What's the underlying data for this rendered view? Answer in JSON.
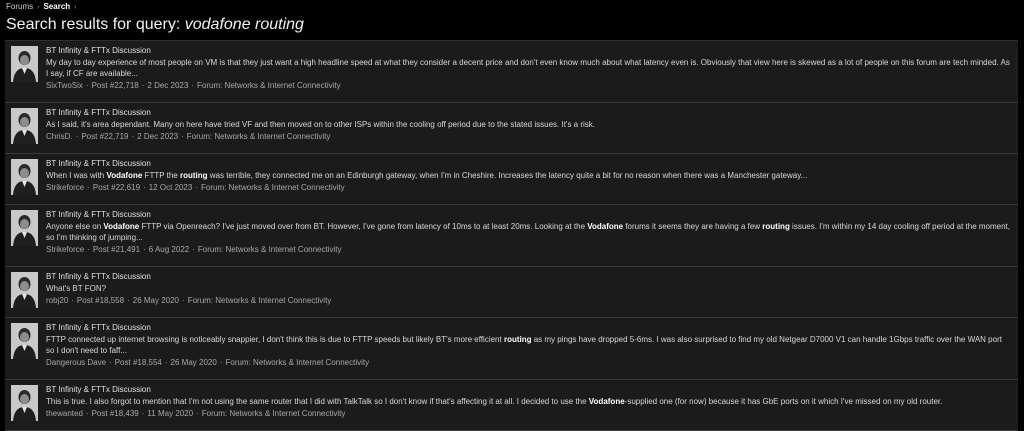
{
  "breadcrumb": {
    "forums": "Forums",
    "search": "Search"
  },
  "page": {
    "title_prefix": "Search results for query:",
    "query": "vodafone routing"
  },
  "results": [
    {
      "thread": "BT Infinity & FTTx Discussion",
      "snippet_html": "My day to day experience of most people on VM is that they just want a high headline speed at what they consider a decent price and don't even know much about what latency even is. Obviously that view here is skewed as a lot of people on this forum are tech minded. As I say, if CF are available...",
      "author": "SixTwoSix",
      "post": "Post #22,718",
      "date": "2 Dec 2023",
      "forum": "Forum: Networks & Internet Connectivity",
      "avatar_year": ""
    },
    {
      "thread": "BT Infinity & FTTx Discussion",
      "snippet_html": "As I said, it's area dependant. Many on here have tried VF and then moved on to other ISPs within the cooling off period due to the stated issues. It's a risk.",
      "author": "ChrisD.",
      "post": "Post #22,719",
      "date": "2 Dec 2023",
      "forum": "Forum: Networks & Internet Connectivity",
      "avatar_year": "2023"
    },
    {
      "thread": "BT Infinity & FTTx Discussion",
      "snippet_html": "When I was with <b>Vodafone</b> FTTP the <b>routing</b> was terrible, they connected me on an Edinburgh gateway, when I'm in Cheshire. Increases the latency quite a bit for no reason when there was a Manchester gateway...",
      "author": "Strikeforce",
      "post": "Post #22,619",
      "date": "12 Oct 2023",
      "forum": "Forum: Networks & Internet Connectivity",
      "avatar_year": ""
    },
    {
      "thread": "BT Infinity & FTTx Discussion",
      "snippet_html": "Anyone else on <b>Vodafone</b> FTTP via Openreach? I've just moved over from BT. However, I've gone from latency of 10ms to at least 20ms. Looking at the <b>Vodafone</b> forums it seems they are having a few <b>routing</b> issues. I'm within my 14 day cooling off period at the moment, so I'm thinking of jumping...",
      "author": "Strikeforce",
      "post": "Post #21,491",
      "date": "6 Aug 2022",
      "forum": "Forum: Networks & Internet Connectivity",
      "avatar_year": ""
    },
    {
      "thread": "BT Infinity & FTTx Discussion",
      "snippet_html": "What's BT FON?",
      "author": "robj20",
      "post": "Post #18,558",
      "date": "26 May 2020",
      "forum": "Forum: Networks & Internet Connectivity",
      "avatar_year": ""
    },
    {
      "thread": "BT Infinity & FTTx Discussion",
      "snippet_html": "FTTP connected up internet browsing is noticeably snappier, I don't think this is due to FTTP speeds but likely BT's more efficient <b>routing</b> as my pings have dropped 5-6ms. I was also surprised to find my old Netgear D7000 V1 can handle 1Gbps traffic over the WAN port so I don't need to faff...",
      "author": "Dangerous Dave",
      "post": "Post #18,554",
      "date": "26 May 2020",
      "forum": "Forum: Networks & Internet Connectivity",
      "avatar_year": ""
    },
    {
      "thread": "BT Infinity & FTTx Discussion",
      "snippet_html": "This is true. I also forgot to mention that I'm not using the same router that I did with TalkTalk so I don't know if that's affecting it at all. I decided to use the <b>Vodafone</b>-supplied one (for now) because it has GbE ports on it which I've missed on my old router.",
      "author": "thewanted",
      "post": "Post #18,439",
      "date": "11 May 2020",
      "forum": "Forum: Networks & Internet Connectivity",
      "avatar_year": ""
    }
  ]
}
